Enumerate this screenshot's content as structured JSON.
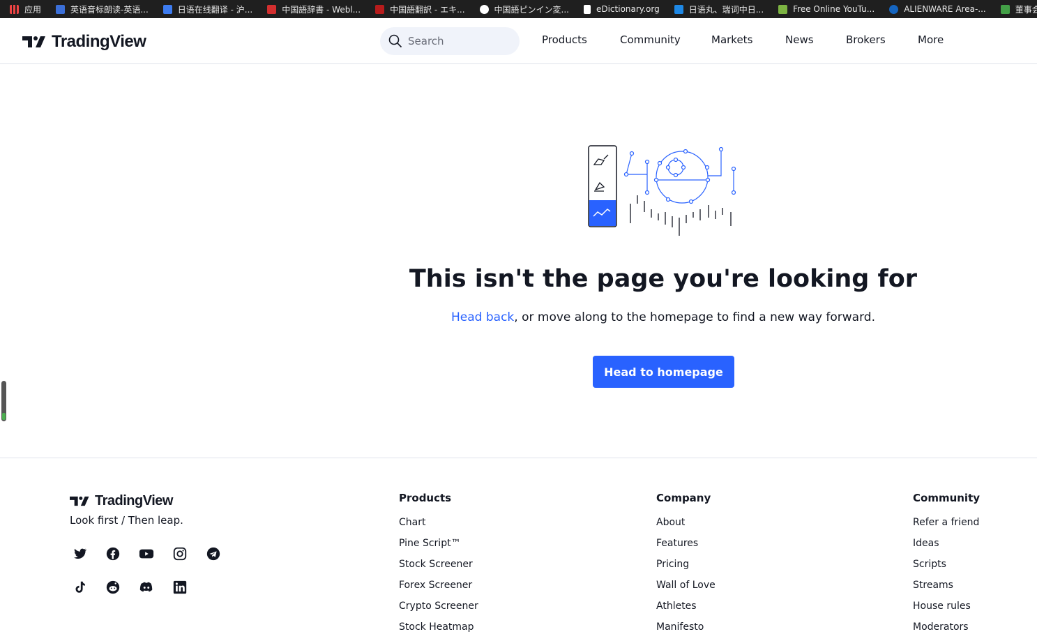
{
  "bookmarks": [
    {
      "label": "应用",
      "icon": "apps-grid-icon",
      "color": "#e44"
    },
    {
      "label": "英语音标朗读-英语...",
      "icon": "site-icon",
      "color": "#3b6fd8"
    },
    {
      "label": "日语在线翻译 - 沪...",
      "icon": "site-icon",
      "color": "#3d7cf0"
    },
    {
      "label": "中国語辞書 - Webl...",
      "icon": "site-icon",
      "color": "#d32f2f"
    },
    {
      "label": "中国語翻訳 - エキ...",
      "icon": "site-icon",
      "color": "#b71c1c"
    },
    {
      "label": "中国語ピンイン変...",
      "icon": "site-icon",
      "color": "#ffffff"
    },
    {
      "label": "eDictionary.org",
      "icon": "document-icon",
      "color": "#ffffff"
    },
    {
      "label": "日语丸、瑞词中日...",
      "icon": "site-icon",
      "color": "#1e88e5"
    },
    {
      "label": "Free Online YouTu...",
      "icon": "download-icon",
      "color": "#7cb342"
    },
    {
      "label": "ALIENWARE Area-...",
      "icon": "site-icon",
      "color": "#1565c0"
    },
    {
      "label": "董事会指数",
      "icon": "site-icon",
      "color": "#43a047"
    }
  ],
  "header": {
    "logo_text": "TradingView",
    "search_placeholder": "Search",
    "nav": [
      "Products",
      "Community",
      "Markets",
      "News",
      "Brokers",
      "More"
    ]
  },
  "main": {
    "headline": "This isn't the page you're looking for",
    "sub_link": "Head back",
    "sub_rest": ", or move along to the homepage to find a new way forward.",
    "cta": "Head to homepage"
  },
  "footer": {
    "logo_text": "TradingView",
    "tagline": "Look first / Then leap.",
    "social": [
      "twitter-icon",
      "facebook-icon",
      "youtube-icon",
      "instagram-icon",
      "telegram-icon",
      "tiktok-icon",
      "reddit-icon",
      "discord-icon",
      "linkedin-icon"
    ],
    "columns": [
      {
        "title": "Products",
        "links": [
          "Chart",
          "Pine Script™",
          "Stock Screener",
          "Forex Screener",
          "Crypto Screener",
          "Stock Heatmap"
        ]
      },
      {
        "title": "Company",
        "links": [
          "About",
          "Features",
          "Pricing",
          "Wall of Love",
          "Athletes",
          "Manifesto"
        ]
      },
      {
        "title": "Community",
        "links": [
          "Refer a friend",
          "Ideas",
          "Scripts",
          "Streams",
          "House rules",
          "Moderators"
        ]
      }
    ]
  },
  "colors": {
    "accent": "#2962ff",
    "text": "#131722",
    "border": "#e0e3eb"
  }
}
